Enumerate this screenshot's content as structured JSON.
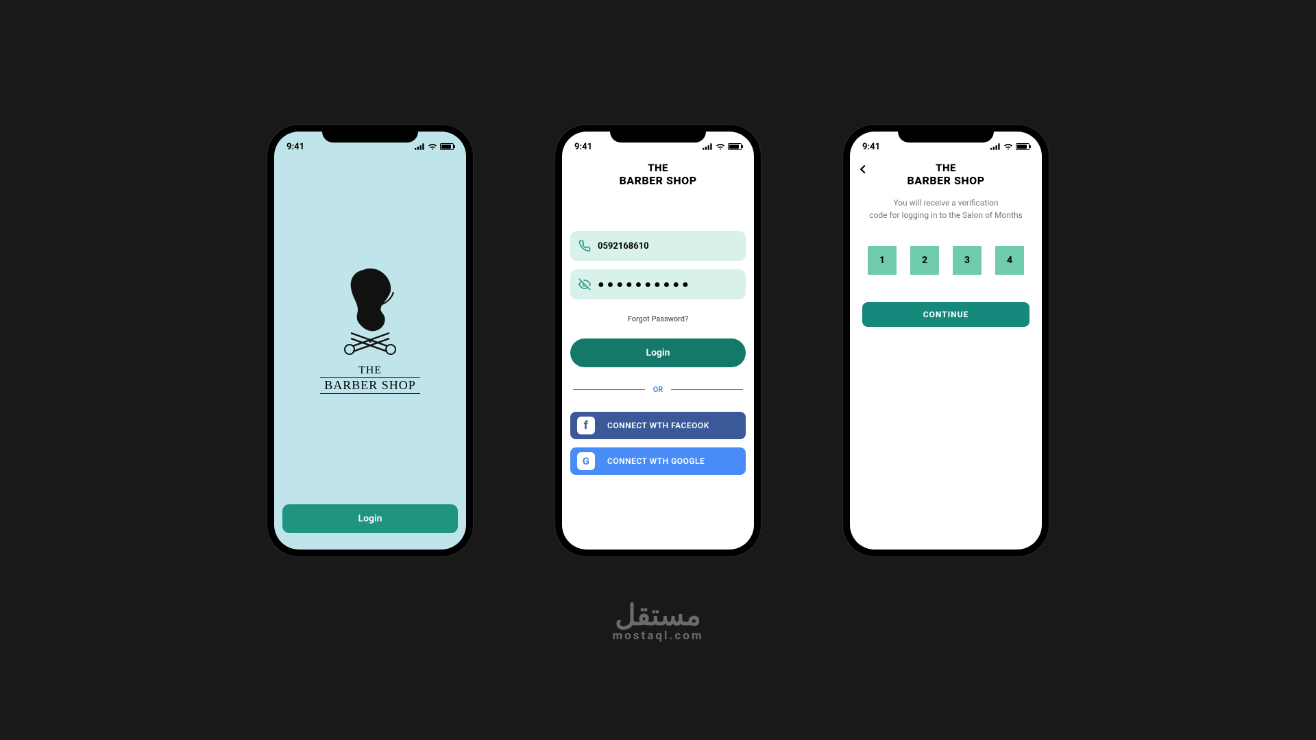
{
  "status": {
    "time": "9:41"
  },
  "brand": {
    "line1": "THE",
    "line2": "BARBER SHOP"
  },
  "screens": {
    "splash": {
      "login_label": "Login"
    },
    "login": {
      "phone_value": "0592168610",
      "password_mask": "●●●●●●●●●●",
      "forgot_label": "Forgot Password?",
      "login_label": "Login",
      "or_label": "OR",
      "facebook_label": "CONNECT WTH FACEOOK",
      "google_label": "CONNECT WTH GOOGLE"
    },
    "verify": {
      "subtitle_line1": "You will receive a verification",
      "subtitle_line2": "code for logging in to the Salon of Months",
      "otp": [
        "1",
        "2",
        "3",
        "4"
      ],
      "continue_label": "CONTINUE"
    }
  },
  "watermark": {
    "arabic": "مستقل",
    "latin": "mostaql.com"
  },
  "colors": {
    "teal": "#1e9481",
    "teal_dark": "#15796a",
    "mint_input": "#d8f1ea",
    "otp": "#6fcba9",
    "fb": "#3b5998",
    "google": "#4a8cf7",
    "splash_bg": "#bfe5ea"
  }
}
